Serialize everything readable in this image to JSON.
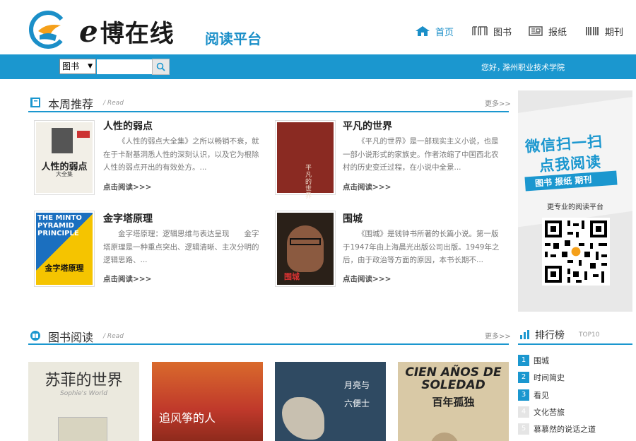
{
  "header": {
    "brand_e": "e",
    "brand_rest": "博在线",
    "subtitle": "阅读平台",
    "nav": [
      {
        "label": "首页",
        "icon": "home-icon"
      },
      {
        "label": "图书",
        "icon": "book-icon"
      },
      {
        "label": "报纸",
        "icon": "newspaper-icon"
      },
      {
        "label": "期刊",
        "icon": "journal-icon"
      }
    ]
  },
  "search": {
    "category": "图书",
    "value": "",
    "greeting": "您好，",
    "school": "滁州职业技术学院"
  },
  "weekly": {
    "title": "本周推荐",
    "sub": "/ Read",
    "more": "更多>>",
    "books": [
      {
        "title": "人性的弱点",
        "desc": "《人性的弱点大全集》之所以畅销不衰，就在于卡耐基洞悉人性的深刻认识，以及它为根除人性的弱点开出的有效处方。...",
        "link": "点击阅读>>>",
        "cover_text": "人性的弱点",
        "cover_sub": "大全集"
      },
      {
        "title": "平凡的世界",
        "desc": "《平凡的世界》是一部现实主义小说，也是一部小说形式的家族史。作者浓缩了中国西北农村的历史变迁过程，在小说中全景...",
        "link": "点击阅读>>>",
        "cover_text": "平凡的世界"
      },
      {
        "title": "金字塔原理",
        "desc": "金字塔原理：逻辑思维与表达呈现　　金字塔原理是一种重点突出、逻辑清晰、主次分明的逻辑思路、...",
        "link": "点击阅读>>>",
        "cover_text": "金字塔原理",
        "cover_top": "THE MINTO PYRAMID PRINCIPLE"
      },
      {
        "title": "围城",
        "desc": "《围城》是钱钟书所著的长篇小说。第一版于1947年由上海晨光出版公司出版。1949年之后，由于政治等方面的原因，本书长期不...",
        "link": "点击阅读>>>",
        "cover_text": "围城"
      }
    ]
  },
  "ad": {
    "line1": "微信扫一扫",
    "line2": "点我阅读",
    "ribbon": "图书 报纸 期刊",
    "tagline": "更专业的阅读平台"
  },
  "reading": {
    "title": "图书阅读",
    "sub": "/ Read",
    "more": "更多>>",
    "covers": [
      {
        "title": "苏菲的世界",
        "sub": "Sophie's World"
      },
      {
        "title": "追风筝的人"
      },
      {
        "title": "月亮与六便士"
      },
      {
        "title": "CIEN AÑOS DE SOLEDAD",
        "sub": "百年孤独"
      }
    ]
  },
  "ranking": {
    "title": "排行榜",
    "sub": "TOP10",
    "items": [
      {
        "num": "1",
        "label": "围城"
      },
      {
        "num": "2",
        "label": "时间简史"
      },
      {
        "num": "3",
        "label": "看见"
      },
      {
        "num": "4",
        "label": "文化苦旅"
      },
      {
        "num": "5",
        "label": "慕慕然的说话之道"
      }
    ]
  },
  "colors": {
    "accent": "#1b97cf",
    "nav_active": "#1b8fc8"
  }
}
